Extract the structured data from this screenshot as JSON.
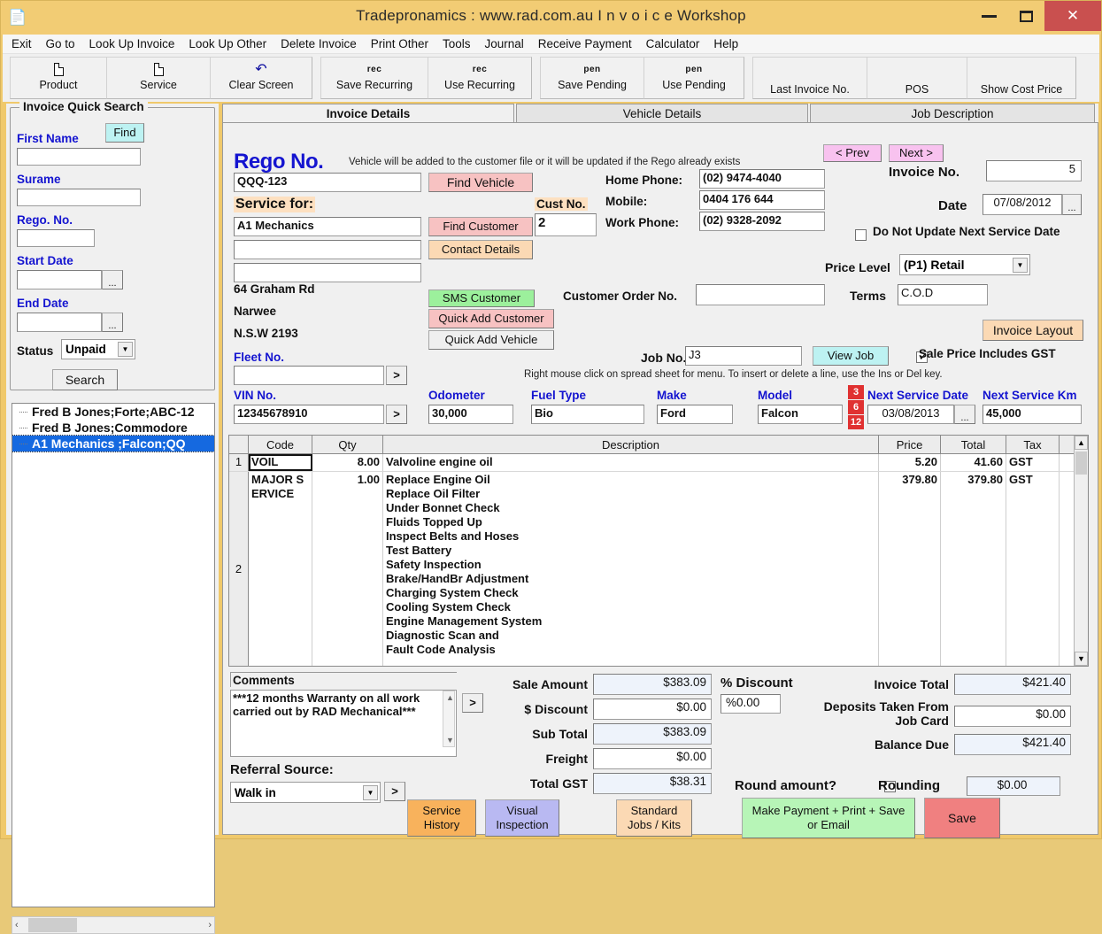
{
  "window": {
    "title": "Tradepronamics :  www.rad.com.au    I n v o i c e   Workshop",
    "minimize": "—",
    "maximize": "❐",
    "close": "✕"
  },
  "menubar": [
    {
      "label": "Exit"
    },
    {
      "label": "Go to"
    },
    {
      "label": "Look Up Invoice"
    },
    {
      "label": "Look Up Other"
    },
    {
      "label": "Delete Invoice"
    },
    {
      "label": "Print Other"
    },
    {
      "label": "Tools"
    },
    {
      "label": "Journal"
    },
    {
      "label": "Receive Payment"
    },
    {
      "label": "Calculator"
    },
    {
      "label": "Help"
    }
  ],
  "toolbar": [
    {
      "icon": "document-icon",
      "icon_text": "",
      "label": "Product"
    },
    {
      "icon": "document-icon",
      "icon_text": "",
      "label": "Service"
    },
    {
      "icon": "undo-arrow-icon",
      "icon_text": "↶",
      "label": "Clear Screen"
    },
    {
      "icon": "rec-icon",
      "icon_text": "rec",
      "label": "Save  Recurring"
    },
    {
      "icon": "rec-icon",
      "icon_text": "rec",
      "label": "Use Recurring"
    },
    {
      "icon": "pen-icon",
      "icon_text": "pen",
      "label": "Save Pending"
    },
    {
      "icon": "pen-icon",
      "icon_text": "pen",
      "label": "Use Pending"
    },
    {
      "icon": "none",
      "icon_text": "",
      "label": "Last Invoice No."
    },
    {
      "icon": "none",
      "icon_text": "",
      "label": "POS"
    },
    {
      "icon": "none",
      "icon_text": "",
      "label": "Show Cost Price"
    }
  ],
  "quick_search": {
    "group_title": "Invoice Quick Search",
    "find_button": "Find",
    "first_name_label": "First Name",
    "first_name_value": "",
    "surname_label": "Surame",
    "surname_value": "",
    "rego_label": "Rego. No.",
    "rego_value": "",
    "start_date_label": "Start Date",
    "start_date_value": "",
    "end_date_label": "End Date",
    "end_date_value": "",
    "dots": "...",
    "status_label": "Status",
    "status_value": "Unpaid",
    "search_button": "Search"
  },
  "results": [
    {
      "label": "Fred B Jones;Forte;ABC-12",
      "selected": false
    },
    {
      "label": "Fred B Jones;Commodore",
      "selected": false
    },
    {
      "label": "A1 Mechanics  ;Falcon;QQ",
      "selected": true
    }
  ],
  "hscroll": {
    "left": "‹",
    "right": "›"
  },
  "tabs": [
    {
      "label": "Invoice Details",
      "active": true
    },
    {
      "label": "Vehicle Details",
      "active": false
    },
    {
      "label": "Job Description",
      "active": false
    }
  ],
  "form": {
    "rego_label": "Rego No.",
    "rego_note": "Vehicle will be added to the customer file or it will be updated if the Rego already exists",
    "rego_value": "QQQ-123",
    "find_vehicle_button": "Find Vehicle",
    "service_for_label": "Service for:",
    "service_for_value": "A1 Mechanics",
    "service_for_line2": "",
    "service_for_line3": "",
    "find_customer_button": "Find Customer",
    "contact_details_button": "Contact Details",
    "cust_no_label": "Cust No.",
    "cust_no_value": "2",
    "address_line1": "64 Graham Rd",
    "address_line2": "Narwee",
    "address_line3": "N.S.W  2193",
    "sms_customer_button": "SMS Customer",
    "quick_add_customer_button": "Quick Add Customer",
    "quick_add_vehicle_button": "Quick Add Vehicle",
    "fleet_no_label": "Fleet No.",
    "fleet_no_value": "",
    "vin_no_label": "VIN No.",
    "vin_no_value": "12345678910",
    "arrow_button": ">",
    "odometer_label": "Odometer",
    "odometer_value": "30,000",
    "fuel_type_label": "Fuel Type",
    "fuel_type_value": "Bio",
    "make_label": "Make",
    "make_value": "Ford",
    "model_label": "Model",
    "model_value": "Falcon",
    "home_phone_label": "Home Phone:",
    "home_phone_value": "(02) 9474-4040",
    "mobile_label": "Mobile:",
    "mobile_value": "0404 176 644",
    "work_phone_label": "Work Phone:",
    "work_phone_value": "(02) 9328-2092",
    "customer_order_label": "Customer Order No.",
    "customer_order_value": "",
    "prev_button": "< Prev",
    "next_button": "Next >",
    "invoice_no_label": "Invoice No.",
    "invoice_no_value": "5",
    "date_label": "Date",
    "date_value": "07/08/2012",
    "date_dots": "...",
    "do_not_update_label": "Do Not Update Next Service Date",
    "do_not_update_checked": false,
    "price_level_label": "Price Level",
    "price_level_value": "(P1) Retail",
    "terms_label": "Terms",
    "terms_value": "C.O.D",
    "invoice_layout_button": "Invoice Layout",
    "job_no_label": "Job No.",
    "job_no_value": "J3",
    "view_job_button": "View Job",
    "sale_price_gst_label": "Sale Price Includes GST",
    "sale_price_gst_checked": true,
    "grid_hint": "Right mouse click on spread sheet for menu. To insert or delete a line, use the Ins or Del key.",
    "service_interval_buttons": [
      "3",
      "6",
      "12"
    ],
    "next_service_date_label": "Next Service Date",
    "next_service_date_value": "03/08/2013",
    "next_service_date_dots": "...",
    "next_service_km_label": "Next Service Km",
    "next_service_km_value": "45,000"
  },
  "grid": {
    "columns": [
      "",
      "Code",
      "Qty",
      "Description",
      "Price",
      "Total",
      "Tax"
    ],
    "rows": [
      {
        "no": "1",
        "code": "VOIL",
        "qty": "8.00",
        "description": [
          "Valvoline engine oil"
        ],
        "price": "5.20",
        "total": "41.60",
        "tax": "GST",
        "selected": true
      },
      {
        "no": "2",
        "code": "MAJOR SERVICE",
        "qty": "1.00",
        "description": [
          "Replace Engine Oil",
          "Replace Oil Filter",
          "Under Bonnet Check",
          "Fluids Topped Up",
          "Inspect Belts and Hoses",
          "Test Battery",
          "Safety Inspection",
          "Brake/HandBr Adjustment",
          "Charging System Check",
          "Cooling System Check",
          "Engine Management System",
          "Diagnostic Scan and",
          "Fault Code Analysis"
        ],
        "price": "379.80",
        "total": "379.80",
        "tax": "GST",
        "selected": false
      }
    ]
  },
  "comments": {
    "label": "Comments",
    "value": "***12 months Warranty on all work carried out by RAD Mechanical***",
    "arrow_button": ">"
  },
  "referral": {
    "label": "Referral Source:",
    "value": "Walk in",
    "arrow_button": ">"
  },
  "totals": {
    "sale_amount_label": "Sale Amount",
    "sale_amount_value": "$383.09",
    "discount_dollar_label": "$ Discount",
    "discount_dollar_value": "$0.00",
    "sub_total_label": "Sub Total",
    "sub_total_value": "$383.09",
    "freight_label": "Freight",
    "freight_value": "$0.00",
    "total_gst_label": "Total GST",
    "total_gst_value": "$38.31",
    "discount_pct_label": "% Discount",
    "discount_pct_value": "%0.00",
    "invoice_total_label": "Invoice Total",
    "invoice_total_value": "$421.40",
    "deposits_label": "Deposits Taken From Job Card",
    "deposits_value": "$0.00",
    "balance_due_label": "Balance Due",
    "balance_due_value": "$421.40",
    "round_amount_label": "Round amount?",
    "round_amount_checked": false,
    "rounding_label": "Rounding",
    "rounding_value": "$0.00"
  },
  "bottom_buttons": {
    "service_history": "Service\nHistory",
    "service_history_l1": "Service",
    "service_history_l2": "History",
    "visual_inspection_l1": "Visual",
    "visual_inspection_l2": "Inspection",
    "standard_jobs_l1": "Standard",
    "standard_jobs_l2": "Jobs / Kits",
    "make_payment_l1": "Make Payment + Print + Save",
    "make_payment_l2": "or Email",
    "save": "Save"
  },
  "colors": {
    "title_bg": "#f2cc74",
    "close_btn": "#c9504f",
    "accent_blue": "#1414d0",
    "selection_blue": "#1569e0",
    "pink_button": "#f7c2c2",
    "green_button": "#9cf09c",
    "red_button": "#f08080",
    "peach_button": "#fbd9b4",
    "lavender_button": "#b9b9f2",
    "orange_button": "#f8b25c",
    "magenta_button": "#f8c2ef",
    "cyan_button": "#bdf2f2",
    "service_tick_red": "#e03131"
  }
}
